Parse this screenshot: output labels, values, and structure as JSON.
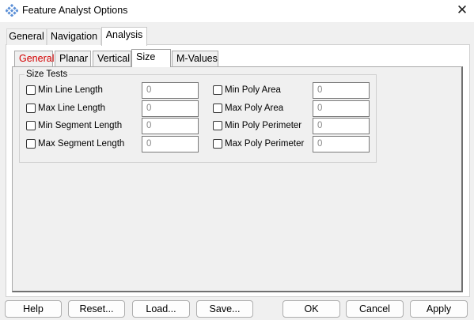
{
  "window": {
    "title": "Feature Analyst Options",
    "close_glyph": "✕"
  },
  "outer_tabs": [
    {
      "label": "General"
    },
    {
      "label": "Navigation"
    },
    {
      "label": "Analysis"
    }
  ],
  "inner_tabs": [
    {
      "label": "General"
    },
    {
      "label": "Planar"
    },
    {
      "label": "Vertical"
    },
    {
      "label": "Size"
    },
    {
      "label": "M-Values"
    }
  ],
  "size_tests": {
    "group_label": "Size Tests",
    "left": [
      {
        "label": "Min Line Length",
        "value": "0"
      },
      {
        "label": "Max Line Length",
        "value": "0"
      },
      {
        "label": "Min Segment Length",
        "value": "0"
      },
      {
        "label": "Max Segment Length",
        "value": "0"
      }
    ],
    "right": [
      {
        "label": "Min Poly Area",
        "value": "0"
      },
      {
        "label": "Max Poly Area",
        "value": "0"
      },
      {
        "label": "Min Poly Perimeter",
        "value": "0"
      },
      {
        "label": "Max Poly Perimeter",
        "value": "0"
      }
    ]
  },
  "buttons": {
    "help": "Help",
    "reset": "Reset...",
    "load": "Load...",
    "save": "Save...",
    "ok": "OK",
    "cancel": "Cancel",
    "apply": "Apply"
  },
  "colors": {
    "active_tab_text": "#d30000",
    "app_icon": "#5b8fd6"
  }
}
